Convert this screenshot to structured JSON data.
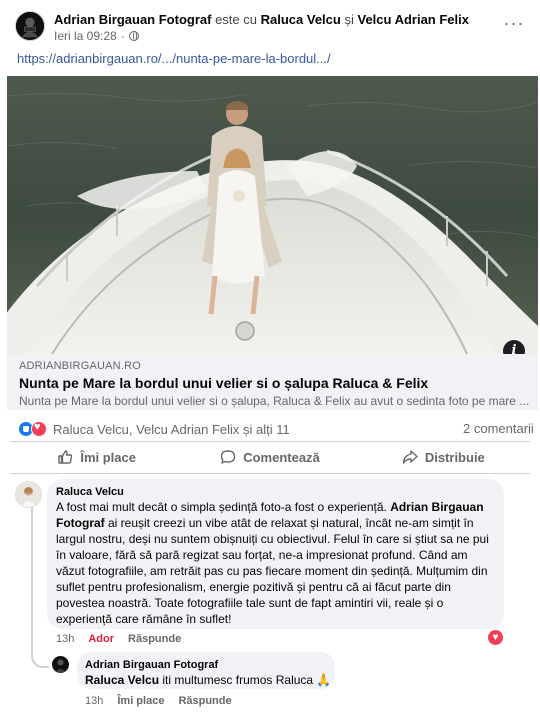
{
  "post": {
    "author": "Adrian Birgauan Fotograf",
    "tag_prefix": "este cu",
    "tagged_1": "Raluca Velcu",
    "tag_conj": "și",
    "tagged_2": "Velcu Adrian Felix",
    "timestamp": "Ieri la 09:28",
    "more_label": "···",
    "link_text": "https://adrianbirgauan.ro/.../nunta-pe-mare-la-bordul.../"
  },
  "preview": {
    "domain": "ADRIANBIRGAUAN.RO",
    "title": "Nunta pe Mare la bordul unui velier si o șalupa Raluca & Felix",
    "description": "Nunta pe Mare la bordul unui velier si o șalupa, Raluca & Felix au avut o sedinta foto pe mare ...",
    "info_label": "i"
  },
  "reactions": {
    "text": "Raluca Velcu, Velcu Adrian Felix și alți 11",
    "comments_count": "2 comentarii"
  },
  "actions": {
    "like": "Îmi place",
    "comment": "Comentează",
    "share": "Distribuie"
  },
  "comments": [
    {
      "author": "Raluca Velcu",
      "text_1": "A fost mai mult decât o simpla ședință foto-a fost o experiență.",
      "text_bold": "Adrian Birgauan Fotograf",
      "text_2": "ai reușit creezi un vibe atât de relaxat și natural, încât ne-am simțit în largul nostru, deși nu suntem obișnuiți cu obiectivul. Felul în care si știut sa ne pui în valoare, fără să pară regizat sau forțat, ne-a impresionat profund. Când am văzut fotografiile, am retrăit pas cu pas fiecare moment din ședință. Mulțumim din suflet pentru profesionalism, energie pozitivă și pentru că ai făcut parte din povestea noastră. Toate fotografiile tale sunt de fapt amintiri vii, reale și o experiență care rămâne în suflet!",
      "time": "13h",
      "tag": "Ador",
      "reply": "Răspunde"
    },
    {
      "author": "Adrian Birgauan Fotograf",
      "text_bold": "Raluca Velcu",
      "text": "iti multumesc frumos Raluca 🙏",
      "time": "13h",
      "like": "Îmi place",
      "reply": "Răspunde"
    }
  ],
  "colors": {
    "link": "#385898",
    "muted": "#65676b",
    "like_blue": "#1877f2",
    "love_red": "#f33e58",
    "bubble": "#f0f2f5"
  }
}
